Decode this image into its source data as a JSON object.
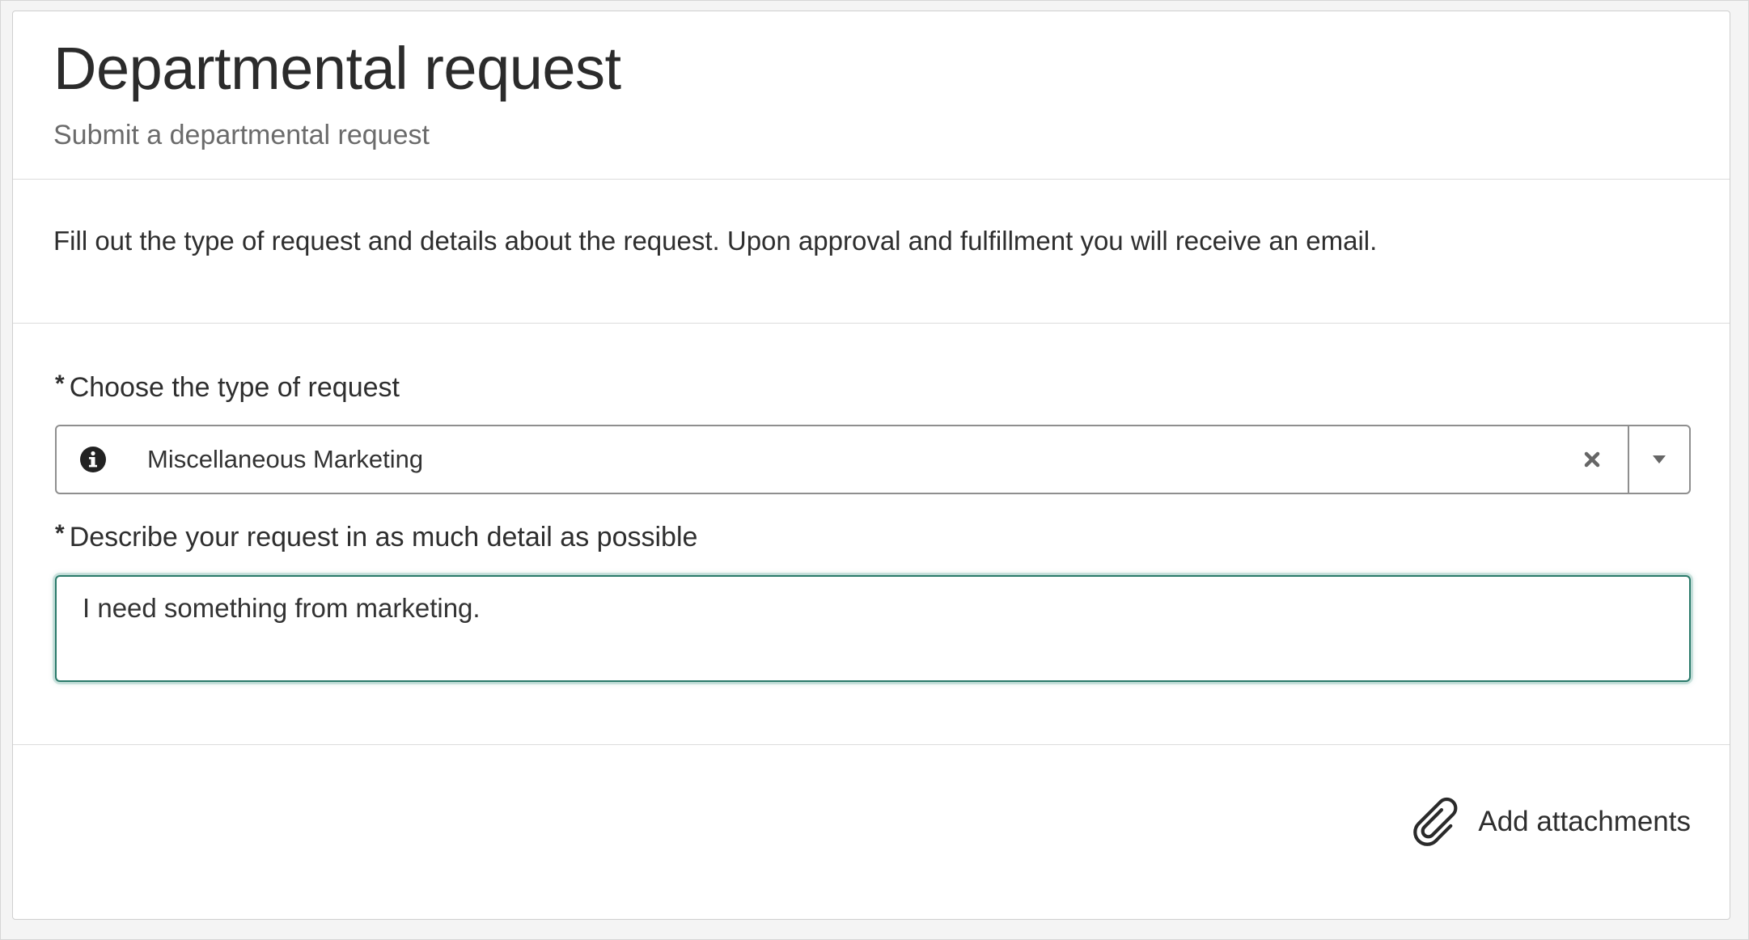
{
  "header": {
    "title": "Departmental request",
    "subtitle": "Submit a departmental request"
  },
  "intro": {
    "text": "Fill out the type of request and details about the request. Upon approval and fulfillment you will receive an email."
  },
  "form": {
    "required_marker": "*",
    "request_type": {
      "label": "Choose the type of request",
      "selected_value": "Miscellaneous Marketing",
      "icon": "info-icon"
    },
    "description": {
      "label": "Describe your request in as much detail as possible",
      "value": "I need something from marketing."
    }
  },
  "footer": {
    "attach_label": "Add attachments",
    "attach_icon": "paperclip-icon"
  },
  "colors": {
    "focus_border": "#2a7a6a"
  }
}
